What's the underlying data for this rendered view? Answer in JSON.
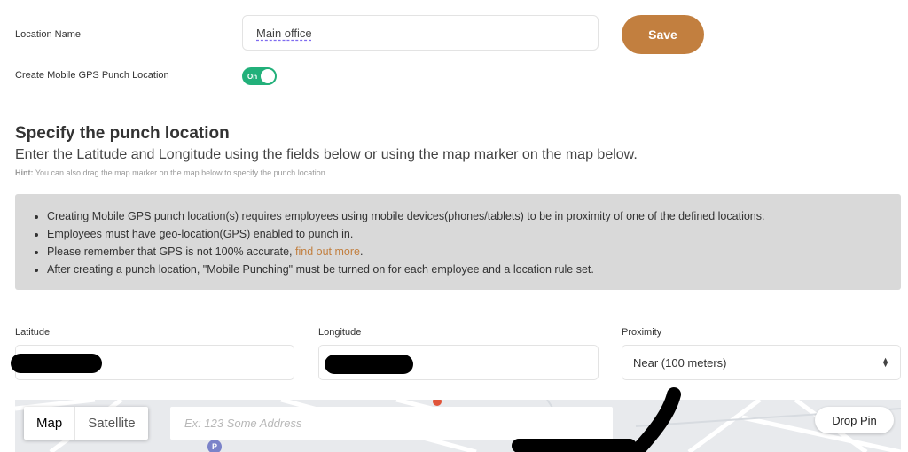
{
  "form": {
    "location_name_label": "Location Name",
    "location_name_value": "Main office",
    "save_label": "Save",
    "gps_label": "Create Mobile GPS Punch Location",
    "gps_toggle_text": "On"
  },
  "punch_section": {
    "title": "Specify the punch location",
    "subtitle": "Enter the Latitude and Longitude using the fields below or using the map marker on the map below.",
    "hint_prefix": "Hint:",
    "hint_text": "You can also drag the map marker on the map below to specify the punch location."
  },
  "info": {
    "item1": "Creating Mobile GPS punch location(s) requires employees using mobile devices(phones/tablets) to be in proximity of one of the defined locations.",
    "item2": "Employees must have geo-location(GPS) enabled to punch in.",
    "item3_prefix": "Please remember that GPS is not 100% accurate,",
    "item3_link": "find out more",
    "item3_suffix": ".",
    "item4": "After creating a punch location, \"Mobile Punching\" must be turned on for each employee and a location rule set."
  },
  "fields": {
    "latitude_label": "Latitude",
    "longitude_label": "Longitude",
    "proximity_label": "Proximity",
    "proximity_value": "Near (100 meters)"
  },
  "map": {
    "type_map": "Map",
    "type_satellite": "Satellite",
    "address_placeholder": "Ex: 123 Some Address",
    "drop_pin_label": "Drop Pin",
    "parking_marker": "P"
  },
  "colors": {
    "accent": "#c27f3f",
    "toggle_on": "#22b07a",
    "info_bg": "#d9d9d9"
  }
}
